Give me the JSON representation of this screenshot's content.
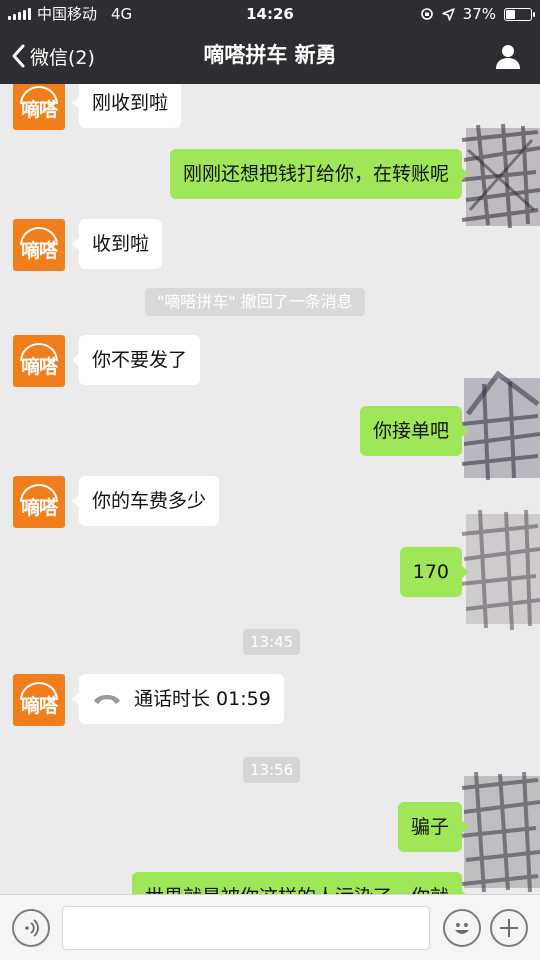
{
  "status_bar": {
    "carrier": "中国移动",
    "network": "4G",
    "time": "14:26",
    "battery_text": "37%",
    "battery_level": 0.37
  },
  "nav": {
    "back_label": "微信(2)",
    "title": "嘀嗒拼车 新勇"
  },
  "avatar_text": "嘀嗒",
  "messages": {
    "m1": "刚收到啦",
    "m2": "刚刚还想把钱打给你，在转账呢",
    "m3": "收到啦",
    "sys1": "\"嘀嗒拼车\" 撤回了一条消息",
    "m4": "你不要发了",
    "m5": "你接单吧",
    "m6": "你的车费多少",
    "m7": "170",
    "ts1": "13:45",
    "m8_call": "通话时长 01:59",
    "ts2": "13:56",
    "m9": "骗子",
    "m10": "世界就是被你这样的人污染了，你就"
  },
  "colors": {
    "header_bg": "#2e2e32",
    "chat_bg": "#ebebeb",
    "outgoing_bubble": "#9fe658",
    "incoming_bubble": "#ffffff",
    "avatar_orange": "#f07e1b"
  },
  "icons": [
    "signal-icon",
    "location-icon",
    "battery-icon",
    "back-chevron-icon",
    "profile-icon",
    "phone-icon",
    "voice-icon",
    "emoji-icon",
    "plus-icon"
  ]
}
